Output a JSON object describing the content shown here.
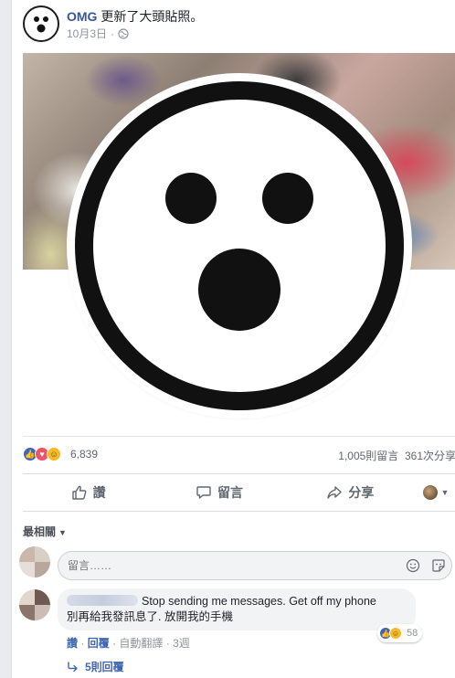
{
  "post": {
    "author": "OMG",
    "action": "更新了大頭貼照。",
    "date": "10月3日",
    "separator": "·",
    "privacy_icon": "globe-icon"
  },
  "reactions": {
    "types": [
      "like-icon",
      "love-icon",
      "haha-icon"
    ],
    "count": "6,839",
    "comments": "1,005則留言",
    "shares": "361次分享"
  },
  "actions": {
    "like": "讚",
    "comment": "留言",
    "share": "分享"
  },
  "comments_section": {
    "sort_label": "最相關",
    "input_placeholder": "留言……",
    "comment": {
      "text_en": "Stop sending me messages. Get off my phone",
      "text_zh": "別再給我發訊息了. 放開我的手機",
      "reaction_count": "58",
      "like_label": "讚",
      "reply_label": "回覆",
      "translate_label": "自動翻譯",
      "age": "3週",
      "dot": "·",
      "replies_label": "5則回覆"
    }
  },
  "colors": {
    "link": "#365899",
    "accent": "#4267b2",
    "muted": "#90949c"
  }
}
